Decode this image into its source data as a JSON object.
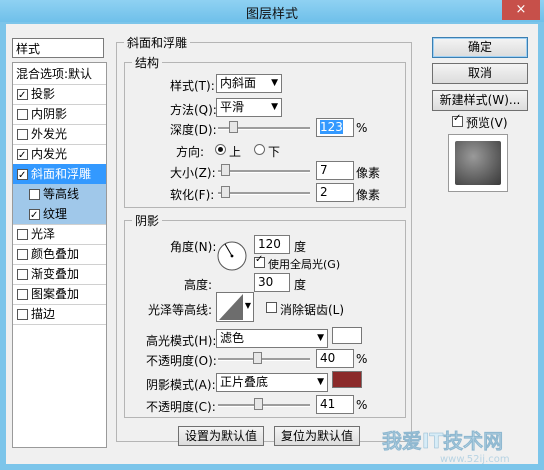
{
  "window": {
    "title": "图层样式",
    "close_label": "×"
  },
  "left_panel": {
    "header": "样式",
    "items": [
      {
        "label": "混合选项:默认",
        "checkbox": false,
        "checked": false
      },
      {
        "label": "投影",
        "checkbox": true,
        "checked": true
      },
      {
        "label": "内阴影",
        "checkbox": true,
        "checked": false
      },
      {
        "label": "外发光",
        "checkbox": true,
        "checked": false
      },
      {
        "label": "内发光",
        "checkbox": true,
        "checked": true
      },
      {
        "label": "斜面和浮雕",
        "checkbox": true,
        "checked": true,
        "selected": true
      },
      {
        "label": "等高线",
        "checkbox": true,
        "checked": false,
        "sub": true
      },
      {
        "label": "纹理",
        "checkbox": true,
        "checked": true,
        "sub": true
      },
      {
        "label": "光泽",
        "checkbox": true,
        "checked": false
      },
      {
        "label": "颜色叠加",
        "checkbox": true,
        "checked": false
      },
      {
        "label": "渐变叠加",
        "checkbox": true,
        "checked": false
      },
      {
        "label": "图案叠加",
        "checkbox": true,
        "checked": false
      },
      {
        "label": "描边",
        "checkbox": true,
        "checked": false
      }
    ]
  },
  "bevel": {
    "group_title": "斜面和浮雕",
    "structure_title": "结构",
    "style_label": "样式(T):",
    "style_value": "内斜面",
    "technique_label": "方法(Q):",
    "technique_value": "平滑",
    "depth_label": "深度(D):",
    "depth_value": "123",
    "depth_unit": "%",
    "depth_level": 0.12,
    "direction_label": "方向:",
    "direction_up": "上",
    "direction_down": "下",
    "size_label": "大小(Z):",
    "size_value": "7",
    "size_unit": "像素",
    "size_level": 0.03,
    "soften_label": "软化(F):",
    "soften_value": "2",
    "soften_unit": "像素",
    "soften_level": 0.03
  },
  "shading": {
    "title": "阴影",
    "angle_label": "角度(N):",
    "angle_value": "120",
    "angle_unit": "度",
    "global_light_label": "使用全局光(G)",
    "global_light_checked": true,
    "altitude_label": "高度:",
    "altitude_value": "30",
    "altitude_unit": "度",
    "gloss_label": "光泽等高线:",
    "antialias_label": "消除锯齿(L)",
    "antialias_checked": false,
    "highlight_label": "高光模式(H):",
    "highlight_value": "滤色",
    "highlight_color": "#ffffff",
    "highlight_opacity_label": "不透明度(O):",
    "highlight_opacity_value": "40",
    "highlight_opacity_unit": "%",
    "highlight_opacity_level": 0.4,
    "shadow_label": "阴影模式(A):",
    "shadow_value": "正片叠底",
    "shadow_color": "#8b2a2a",
    "shadow_opacity_label": "不透明度(C):",
    "shadow_opacity_value": "41",
    "shadow_opacity_unit": "%",
    "shadow_opacity_level": 0.41
  },
  "bottom_buttons": {
    "set_default": "设置为默认值",
    "reset_default": "复位为默认值"
  },
  "right_panel": {
    "ok": "确定",
    "cancel": "取消",
    "new_style": "新建样式(W)...",
    "preview_label": "预览(V)",
    "preview_checked": true
  },
  "watermark": {
    "text": "我爱IT技术网",
    "url": "www.52ij.com"
  }
}
